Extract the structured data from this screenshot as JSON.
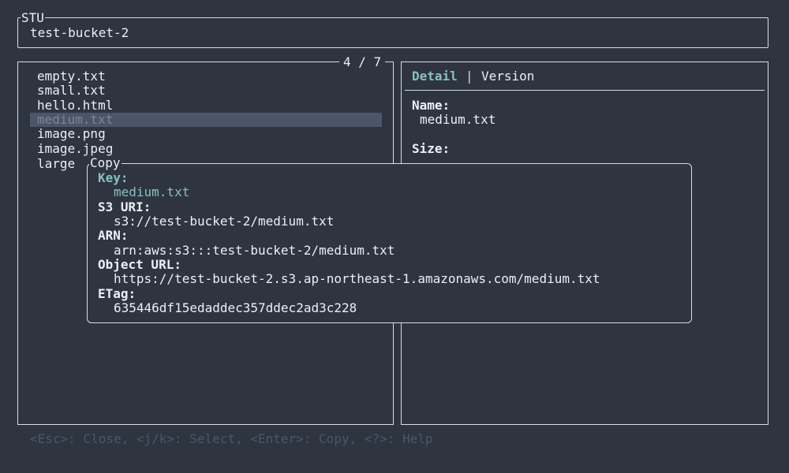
{
  "app": {
    "title": "STU"
  },
  "header": {
    "bucket": "test-bucket-2"
  },
  "list": {
    "count": "4 / 7",
    "items": [
      "empty.txt",
      "small.txt",
      "hello.html",
      "medium.txt",
      "image.png",
      "image.jpeg",
      "large"
    ],
    "selected_index": 3
  },
  "detail": {
    "tabs": [
      "Detail",
      "Version"
    ],
    "active_tab": "Detail",
    "tab_separator": "|",
    "fields": [
      {
        "label": "Name:",
        "value": "medium.txt"
      },
      {
        "label": "Size:",
        "value": ""
      }
    ]
  },
  "copy_dialog": {
    "title": "Copy",
    "selected_index": 0,
    "entries": [
      {
        "label": "Key:",
        "value": "medium.txt"
      },
      {
        "label": "S3 URI:",
        "value": "s3://test-bucket-2/medium.txt"
      },
      {
        "label": "ARN:",
        "value": "arn:aws:s3:::test-bucket-2/medium.txt"
      },
      {
        "label": "Object URL:",
        "value": "https://test-bucket-2.s3.ap-northeast-1.amazonaws.com/medium.txt"
      },
      {
        "label": "ETag:",
        "value": "635446df15edaddec357ddec2ad3c228"
      }
    ]
  },
  "footer": {
    "help": "<Esc>: Close, <j/k>: Select, <Enter>: Copy, <?>: Help"
  },
  "colors": {
    "background": "#2e3440",
    "foreground": "#eceff4",
    "accent": "#88c0c0",
    "selection": "#4c566a",
    "muted": "#4c566a"
  }
}
